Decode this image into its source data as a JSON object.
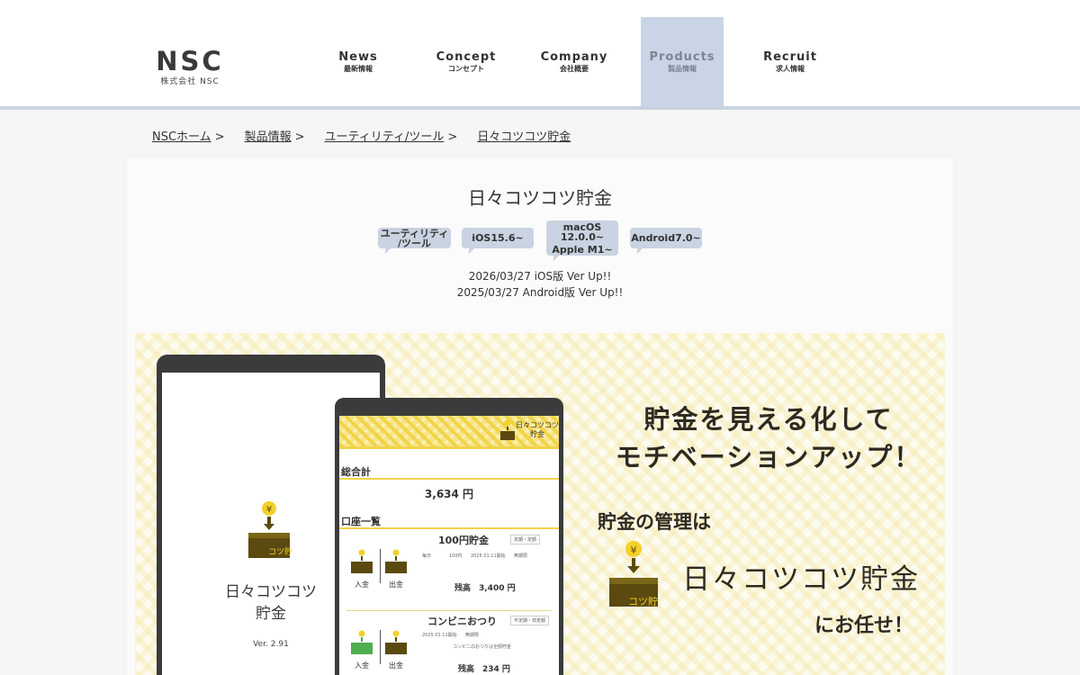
{
  "header": {
    "logo": {
      "main": "NSC",
      "sub": "株式会社 NSC"
    },
    "nav": [
      {
        "en": "News",
        "jp": "最新情報"
      },
      {
        "en": "Concept",
        "jp": "コンセプト"
      },
      {
        "en": "Company",
        "jp": "会社概要"
      },
      {
        "en": "Products",
        "jp": "製品情報",
        "active": true
      },
      {
        "en": "Recruit",
        "jp": "求人情報"
      }
    ]
  },
  "breadcrumb": {
    "items": [
      "NSCホーム",
      "製品情報",
      "ユーティリティ/ツール",
      "日々コツコツ貯金"
    ],
    "separator": ">"
  },
  "product": {
    "title": "日々コツコツ貯金",
    "tags": [
      {
        "line1": "ユーティリティ",
        "line2": "/ツール"
      },
      {
        "line1": "iOS15.6~",
        "line2": ""
      },
      {
        "line1": "macOS 12.0.0~",
        "line2": "Apple M1~"
      },
      {
        "line1": "Android7.0~",
        "line2": ""
      }
    ],
    "updates": [
      "2026/03/27 iOS版 Ver Up!!",
      "2025/03/27 Android版 Ver Up!!"
    ]
  },
  "banner": {
    "tablet": {
      "app_line1": "日々コツコツ",
      "app_line2": "貯金",
      "version": "Ver. 2.91",
      "icon_label": "コツ貯"
    },
    "phone": {
      "header_title_1": "日々コツコツ",
      "header_title_2": "貯金",
      "total_label": "総合計",
      "total_value": "3,634 円",
      "accounts_label": "口座一覧",
      "accounts": [
        {
          "name": "100円貯金",
          "chip": "定期・定額",
          "meta": [
            "毎日",
            "100円",
            "2025.01.11開始",
            "無期限"
          ],
          "balance": "残高　3,400 円",
          "in": "入金",
          "out": "出金"
        },
        {
          "name": "コンビニおつり",
          "chip": "不定期・非定額",
          "meta": [
            "2025.01.11開始",
            "無期限"
          ],
          "note": "コンビニのおつりは全額貯金",
          "balance": "残高　234 円",
          "in": "入金",
          "out": "出金"
        }
      ]
    },
    "copy": {
      "line1": "貯金を見える化して",
      "line2": "モチベーションアップ！",
      "line3": "貯金の管理は",
      "line4": "日々コツコツ貯金",
      "line5": "にお任せ！",
      "icon_label": "コツ貯"
    }
  },
  "colors": {
    "accent": "#c9d5e6",
    "yellow": "#f0d34a",
    "icon_brown": "#5a4a10",
    "green": "#4fae4f"
  }
}
